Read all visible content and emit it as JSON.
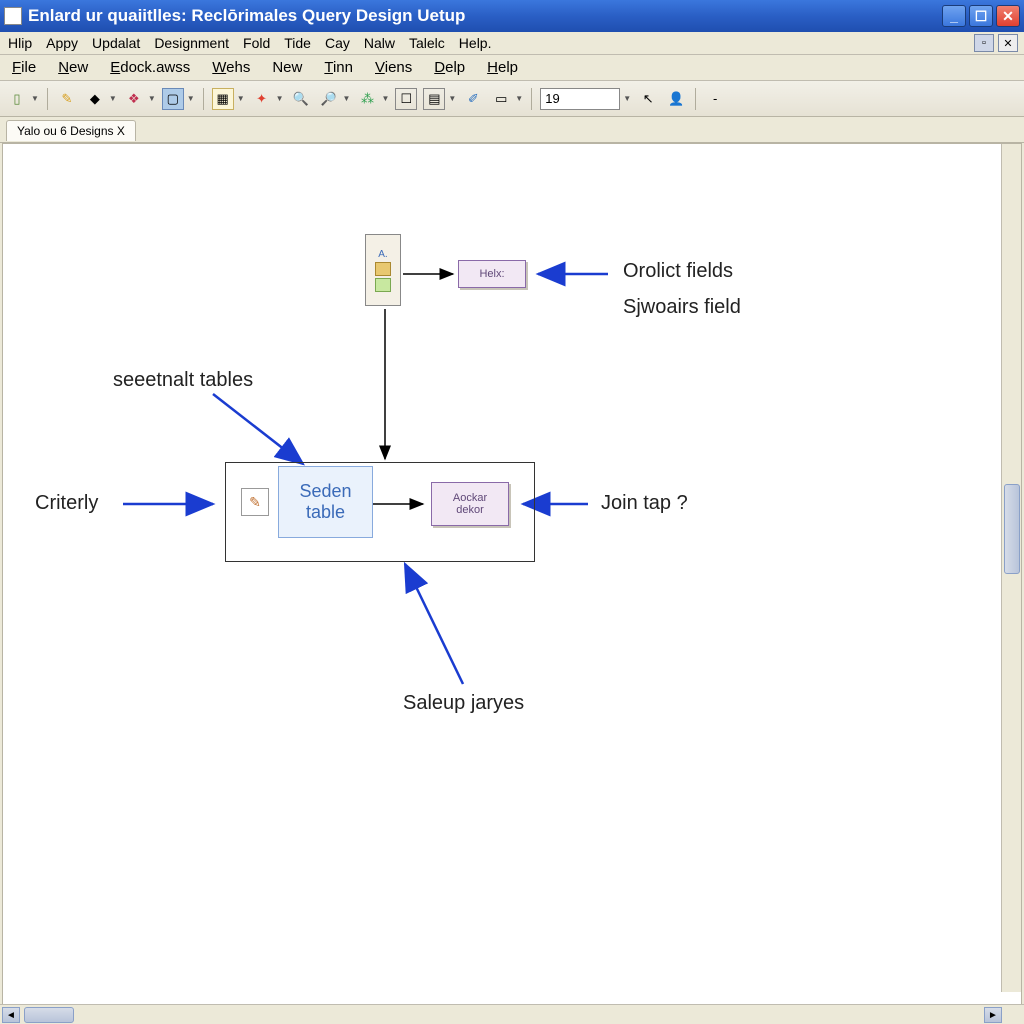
{
  "title": "Enlard ur quaiitlles: Reclōrimales Query Design Uetup",
  "menubar1": [
    "Hlip",
    "Appy",
    "Updalat",
    "Designment",
    "Fold",
    "Tide",
    "Cay",
    "Nalw",
    "Talelc",
    "Help."
  ],
  "menubar2": [
    "File",
    "New",
    "Edock.awss",
    "Wehs",
    "New",
    "Tinn",
    "Viens",
    "Delp",
    "Help"
  ],
  "zoom_value": "19",
  "tab": "Yalo ou 6 Designs X",
  "diagram": {
    "top_small_box": "Helx:",
    "seden_line1": "Seden",
    "seden_line2": "table",
    "right_small_box_line1": "Aockar",
    "right_small_box_line2": "dekor",
    "label_topright1": "Orolict fields",
    "label_topright2": "Sjwoairs field",
    "label_seeetnalt": "seeetnalt tables",
    "label_criterly": "Criterly",
    "label_joint": "Join tap ?",
    "label_saleup": "Saleup jaryes"
  }
}
